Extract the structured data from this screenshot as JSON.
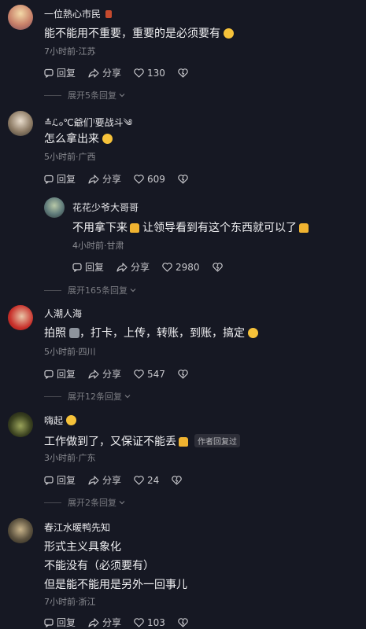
{
  "comments": [
    {
      "name": "一位熱心市民",
      "text": "能不能用不重要，重要的是必须要有",
      "time_location": "7小时前·江苏",
      "reply_label": "回复",
      "share_label": "分享",
      "likes": "130",
      "expand": "展开5条回复"
    },
    {
      "name": "≛ℒℴ℃爺们⁾要战斗༄",
      "text": "怎么拿出来",
      "time_location": "5小时前·广西",
      "reply_label": "回复",
      "share_label": "分享",
      "likes": "609"
    },
    {
      "name": "花花少爷大哥哥",
      "text_a": "不用拿下来",
      "text_b": "让领导看到有这个东西就可以了",
      "time_location": "4小时前·甘肃",
      "reply_label": "回复",
      "share_label": "分享",
      "likes": "2980",
      "expand": "展开165条回复"
    },
    {
      "name": "人潮人海",
      "text_a": "拍照",
      "text_b": "，打卡，上传，转账，到账，搞定",
      "time_location": "5小时前·四川",
      "reply_label": "回复",
      "share_label": "分享",
      "likes": "547",
      "expand": "展开12条回复"
    },
    {
      "name": "嗨起",
      "text": "工作做到了，又保证不能丢",
      "author_tag": "作者回复过",
      "time_location": "3小时前·广东",
      "reply_label": "回复",
      "share_label": "分享",
      "likes": "24",
      "expand": "展开2条回复"
    },
    {
      "name": "春江水暖鸭先知",
      "lines": [
        "形式主义具象化",
        "不能没有（必须要有）",
        "但是能不能用是另外一回事儿"
      ],
      "time_location": "7小时前·浙江",
      "reply_label": "回复",
      "share_label": "分享",
      "likes": "103"
    }
  ],
  "colors": {
    "background": "#161823",
    "meta": "#8a8b91",
    "tag_bg": "#2d2e38"
  },
  "icons": [
    "reply-icon",
    "share-icon",
    "heart-icon",
    "dislike-icon",
    "chevron-down-icon"
  ]
}
